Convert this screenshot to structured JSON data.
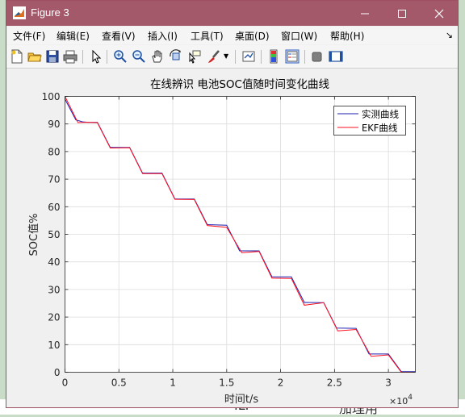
{
  "window": {
    "title": "Figure 3"
  },
  "menu": [
    {
      "label": "文件(F)"
    },
    {
      "label": "编辑(E)"
    },
    {
      "label": "查看(V)"
    },
    {
      "label": "插入(I)"
    },
    {
      "label": "工具(T)"
    },
    {
      "label": "桌面(D)"
    },
    {
      "label": "窗口(W)"
    },
    {
      "label": "帮助(H)"
    }
  ],
  "toolbar_icons": [
    "new-figure-icon",
    "open-icon",
    "save-icon",
    "print-icon",
    "pointer-icon",
    "zoom-in-icon",
    "zoom-out-icon",
    "pan-icon",
    "rotate-icon",
    "data-cursor-icon",
    "brush-icon",
    "link-icon",
    "colorbar-icon",
    "legend-icon",
    "hide-plot-tools-icon",
    "show-plot-tools-icon"
  ],
  "background_fragments": [
    "ILF",
    "加理用"
  ],
  "chart_data": {
    "type": "line",
    "title": "在线辨识 电池SOC值随时间变化曲线",
    "xlabel": "时间t/s",
    "ylabel": "SOC值%",
    "xlim": [
      0,
      32500
    ],
    "ylim": [
      0,
      100
    ],
    "x_exponent_label": "×10",
    "x_exponent_power": "4",
    "xticks": [
      0,
      5000,
      10000,
      15000,
      20000,
      25000,
      30000
    ],
    "xtick_labels": [
      "0",
      "0.5",
      "1",
      "1.5",
      "2",
      "2.5",
      "3"
    ],
    "yticks": [
      0,
      10,
      20,
      30,
      40,
      50,
      60,
      70,
      80,
      90,
      100
    ],
    "ytick_labels": [
      "0",
      "10",
      "20",
      "30",
      "40",
      "50",
      "60",
      "70",
      "80",
      "90",
      "100"
    ],
    "grid": true,
    "legend_position": "top-right",
    "series": [
      {
        "name": "实测曲线",
        "color": "#1f1fb0",
        "x": [
          0,
          1000,
          1600,
          2100,
          3000,
          4200,
          6000,
          7200,
          9000,
          10200,
          12000,
          13200,
          15000,
          16200,
          18000,
          19200,
          21000,
          22200,
          24000,
          25200,
          27000,
          28200,
          30000,
          31200,
          32500
        ],
        "y": [
          99,
          91.5,
          90.8,
          90.6,
          90.6,
          81.5,
          81.5,
          72.2,
          72.2,
          62.8,
          62.8,
          53.5,
          53.3,
          44.0,
          44.0,
          34.6,
          34.6,
          25.3,
          25.2,
          16.0,
          15.9,
          6.6,
          6.6,
          0.2,
          0.2
        ]
      },
      {
        "name": "EKF曲线",
        "color": "#ff1020",
        "x": [
          0,
          1200,
          2000,
          3000,
          4200,
          6000,
          7200,
          9000,
          10200,
          12000,
          13200,
          15000,
          16400,
          18000,
          19200,
          21000,
          22200,
          24000,
          25300,
          27000,
          28400,
          30000,
          31200,
          32500
        ],
        "y": [
          100,
          90.5,
          90.6,
          90.5,
          81.3,
          81.4,
          72.0,
          72.0,
          62.7,
          62.6,
          53.2,
          52.5,
          43.3,
          43.8,
          34.1,
          34.0,
          24.3,
          25.2,
          15.0,
          15.5,
          5.8,
          6.3,
          0.0,
          0.0
        ]
      }
    ]
  }
}
